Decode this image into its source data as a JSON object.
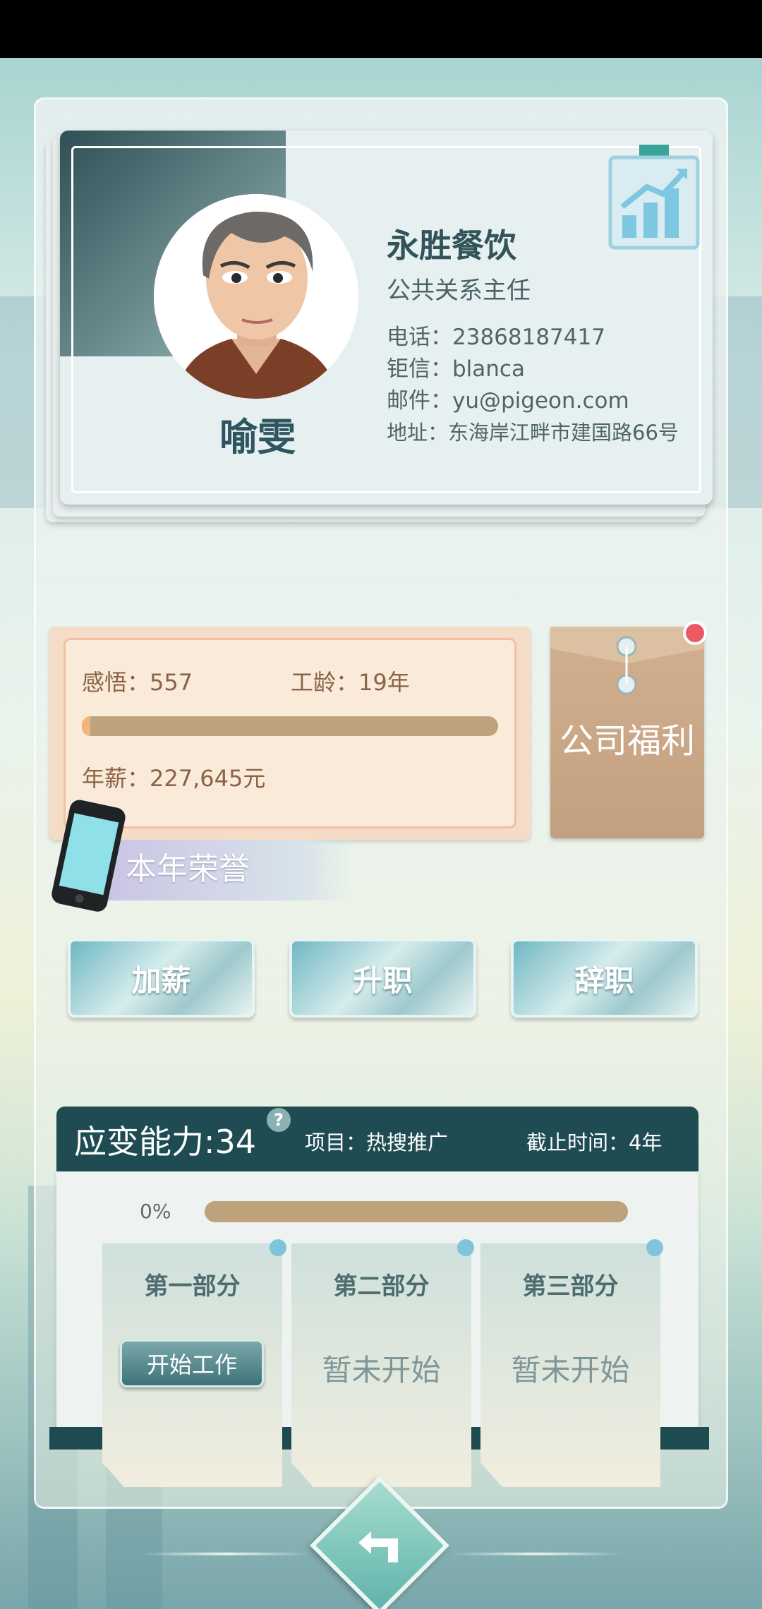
{
  "profile": {
    "name": "喻雯",
    "company": "永胜餐饮",
    "job_title": "公共关系主任",
    "phone": "电话：23868187417",
    "chat": "钜信：blanca",
    "email": "邮件：yu@pigeon.com",
    "address": "地址：东海岸江畔市建国路66号"
  },
  "stats": {
    "insight": "感悟：557",
    "seniority": "工龄：19年",
    "salary": "年薪：227,645元",
    "insight_progress": 0.01
  },
  "welfare": {
    "label": "公司福利"
  },
  "honor": {
    "label": "本年荣誉"
  },
  "actions": {
    "raise": "加薪",
    "promote": "升职",
    "resign": "辞职"
  },
  "work": {
    "ability": "应变能力:34",
    "help": "?",
    "project": "项目：热搜推广",
    "deadline": "截止时间：4年",
    "progress_label": "0%",
    "progress": 0,
    "parts": [
      {
        "title": "第一部分",
        "status": "开始工作"
      },
      {
        "title": "第二部分",
        "status": "暂未开始"
      },
      {
        "title": "第三部分",
        "status": "暂未开始"
      }
    ]
  },
  "colors": {
    "header_bg": "#1f4c52",
    "accent_progress": "#bea27c",
    "badge_red": "#ee5a63"
  },
  "icons": {
    "chart": "growth-chart-icon",
    "back": "return-arrow-icon",
    "phone": "phone-icon",
    "help": "question-icon"
  }
}
